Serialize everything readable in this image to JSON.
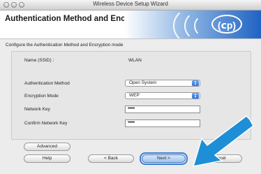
{
  "window": {
    "title": "Wireless Device Setup Wizard"
  },
  "header": {
    "heading": "Authentication Method and Encryption Mode"
  },
  "brand": {
    "logo_text": "(сp)"
  },
  "subtitle": "Configure the Authentication Method and Encryption mode",
  "form": {
    "ssid_label": "Name (SSID) :",
    "ssid_value": "WLAN",
    "auth_label": "Authentication Method",
    "auth_value": "Open System",
    "enc_label": "Encryption Mode",
    "enc_value": "WEP",
    "key_label": "Network Key",
    "key_value": "•••••",
    "confirm_label": "Confirm Network Key",
    "confirm_value": "•••••"
  },
  "buttons": {
    "advanced": "Advanced",
    "help": "Help",
    "back": "< Back",
    "next": "Next >",
    "cancel": "Cancel"
  },
  "colors": {
    "accent": "#1f63c4",
    "arrow": "#1e8fd6"
  },
  "icons": {
    "stepper": "up-down-chevron-icon",
    "pointer": "pointing-arrow-icon"
  }
}
